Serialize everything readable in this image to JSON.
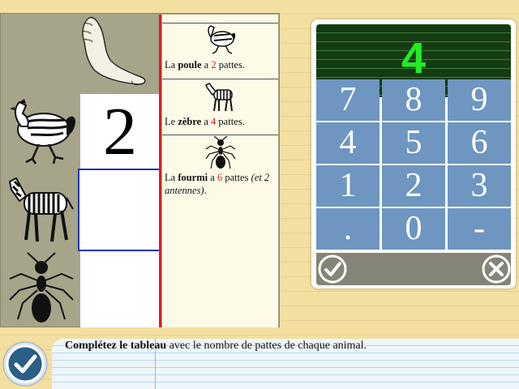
{
  "left_panel": {
    "cells": [
      {
        "name": "foot",
        "icon": "foot-image"
      },
      {
        "name": "hen",
        "icon": "hen-image"
      },
      {
        "name": "zebra",
        "icon": "zebra-image"
      },
      {
        "name": "ant",
        "icon": "ant-image"
      }
    ],
    "given_value": "2",
    "answer_value": ""
  },
  "info": {
    "items": [
      {
        "prefix": "La ",
        "animal": "poule",
        "mid": " a ",
        "num": "2",
        "suffix": " pattes.",
        "extra": "",
        "icon": "hen-icon"
      },
      {
        "prefix": "Le ",
        "animal": "zèbre",
        "mid": " a ",
        "num": "4",
        "suffix": " pattes.",
        "extra": "",
        "icon": "zebra-icon"
      },
      {
        "prefix": "La ",
        "animal": "fourmi",
        "mid": " a ",
        "num": "6",
        "suffix": " pattes ",
        "extra": "(et 2 antennes)",
        "extra_end": ".",
        "icon": "ant-icon"
      }
    ]
  },
  "keypad": {
    "display": "4",
    "keys": [
      "7",
      "8",
      "9",
      "4",
      "5",
      "6",
      "1",
      "2",
      "3",
      ".",
      "0",
      "-"
    ],
    "ok_icon": "check-circle-icon",
    "cancel_icon": "cross-circle-icon"
  },
  "instruction": {
    "bold": "Complétez le tableau",
    "rest": " avec le nombre de pattes de chaque animal."
  },
  "colors": {
    "accent_red": "#d42020",
    "key_blue": "#6e96c0",
    "display_green": "#22ee22"
  }
}
